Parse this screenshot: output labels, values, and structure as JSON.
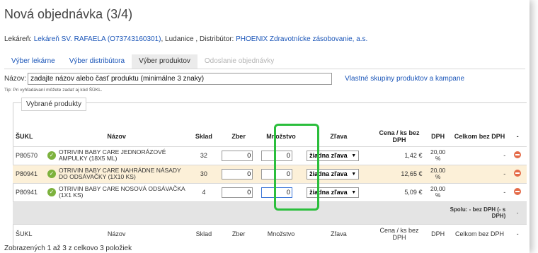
{
  "page": {
    "title": "Nová objednávka (3/4)",
    "info": {
      "pharmacy_label": "Lekáreň:",
      "pharmacy_name": "Lekáreň SV. RAFAELA (O73743160301)",
      "city": ", Ludanice ,",
      "distributor_label": "Distribútor:",
      "distributor_name": "PHOENIX Zdravotnícke zásobovanie, a.s."
    },
    "tabs": [
      "Výber lekárne",
      "Výber distribútora",
      "Výber produktov",
      "Odoslanie objednávky"
    ],
    "search": {
      "label": "Názov:",
      "placeholder": "zadajte názov alebo časť produktu (minimálne 3 znaky)",
      "groups_link": "Vlastné skupiny produktov a kampane",
      "tip": "Tip: Pri vyhľadávaní môžete zadať aj kód ŠÚKL."
    },
    "selected_legend": "Vybrané produkty",
    "footer": "Zobrazených 1 až 3 z celkovo 3 položiek"
  },
  "table": {
    "headers": {
      "sukl": "ŠUKL",
      "name": "Názov",
      "sklad": "Sklad",
      "zber": "Zber",
      "mnozstvo": "Množstvo",
      "zlava": "Zľava",
      "cena": "Cena / ks bez DPH",
      "dph": "DPH",
      "celkom": "Celkom bez DPH",
      "action": "-"
    },
    "rows": [
      {
        "sukl": "P80570",
        "name": "OTRIVIN BABY CARE JEDNORÁZOVÉ AMPULKY (18x5 ml)",
        "sklad": "32",
        "zber": "0",
        "mnozstvo": "0",
        "zlava": "žiadna zľava",
        "cena": "1,42 €",
        "dph": "20,00 %",
        "celkom": "-"
      },
      {
        "sukl": "P80941",
        "name": "OTRIVIN BABY CARE NAHRÁDNE NÁSADY DO ODSÁVAČKY (1x10 ks)",
        "sklad": "30",
        "zber": "0",
        "mnozstvo": "0",
        "zlava": "žiadna zľava",
        "cena": "12,65 €",
        "dph": "20,00 %",
        "celkom": "-"
      },
      {
        "sukl": "P80941",
        "name": "OTRIVIN BABY CARE NOSOVÁ ODSÁVAČKA (1x1 ks)",
        "sklad": "4",
        "zber": "0",
        "mnozstvo": "0",
        "zlava": "žiadna zľava",
        "cena": "5,09 €",
        "dph": "20,00 %",
        "celkom": "-"
      }
    ],
    "sum": {
      "label": "Spolu: - bez DPH (- s DPH)",
      "action": "-"
    },
    "footer_headers": {
      "sukl": "ŠUKL",
      "name": "Názov",
      "sklad": "Sklad",
      "zber": "Zber",
      "mnozstvo": "Množstvo",
      "zlava": "Zľava",
      "cena": "Cena / ks bez DPH",
      "dph": "DPH",
      "celkom": "Celkom bez DPH",
      "action": "-"
    }
  },
  "colors": {
    "highlight": "#2bbe3c",
    "link": "#1a55b8",
    "alt_row": "#fcf0d8"
  }
}
